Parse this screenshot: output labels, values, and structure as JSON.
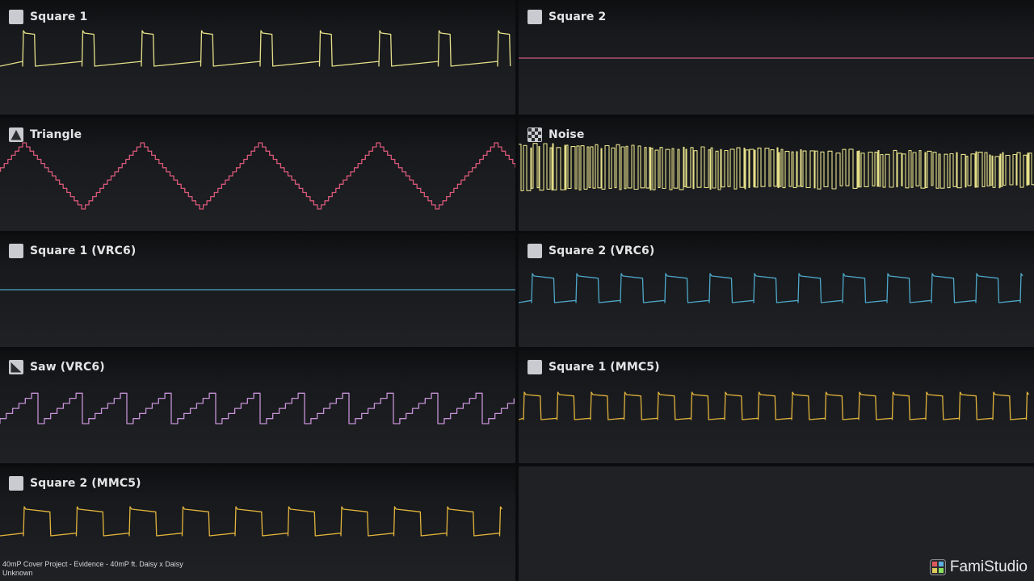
{
  "channels": [
    {
      "name": "Square 1",
      "icon": "square-wave-icon",
      "wave": "square",
      "color": "#e6e08a",
      "period": 73.5,
      "phase": 28,
      "duty": 0.2,
      "amp": 22,
      "center": 60,
      "slope": 0.1,
      "level": 0.8
    },
    {
      "name": "Square 2",
      "icon": "square-wave-icon",
      "wave": "flat",
      "color": "#d05a7e",
      "center": 72,
      "level": 0
    },
    {
      "name": "Triangle",
      "icon": "triangle-wave-icon",
      "wave": "triangle",
      "color": "#d9587a",
      "period": 146,
      "phase": 28,
      "amp": 41,
      "center": 218,
      "steps": 16,
      "level": 0.9
    },
    {
      "name": "Noise",
      "icon": "noise-icon",
      "wave": "noise",
      "color": "#e6e08a",
      "center": 208,
      "amp": 28,
      "level": 0.75
    },
    {
      "name": "Square 1 (VRC6)",
      "icon": "square-wave-icon",
      "wave": "flat",
      "color": "#4fa8c9",
      "center": 359,
      "level": 0
    },
    {
      "name": "Square 2 (VRC6)",
      "icon": "square-wave-icon",
      "wave": "square",
      "color": "#4fa8c9",
      "period": 55,
      "phase": 16,
      "duty": 0.5,
      "amp": 18,
      "center": 357,
      "slope": 0.1,
      "level": 0.7
    },
    {
      "name": "Saw (VRC6)",
      "icon": "saw-wave-icon",
      "wave": "saw",
      "color": "#c792d8",
      "period": 55,
      "phase": 47,
      "amp": 22,
      "center": 503,
      "steps": 7,
      "level": 0.75
    },
    {
      "name": "Square 1 (MMC5)",
      "icon": "square-wave-icon",
      "wave": "square",
      "color": "#e2b43c",
      "period": 41.5,
      "phase": 6,
      "duty": 0.5,
      "amp": 17,
      "center": 503,
      "slope": 0.08,
      "level": 0.65
    },
    {
      "name": "Square 2 (MMC5)",
      "icon": "square-wave-icon",
      "wave": "square",
      "color": "#e2b43c",
      "period": 65.5,
      "phase": 29,
      "duty": 0.5,
      "amp": 18,
      "center": 646,
      "slope": 0.1,
      "level": 0.7
    }
  ],
  "footer": {
    "title": "40mP Cover Project - Evidence - 40mP ft. Daisy x Daisy",
    "author": "Unknown"
  },
  "brand": {
    "name": "FamiStudio",
    "icon": "famistudio-logo-icon"
  }
}
